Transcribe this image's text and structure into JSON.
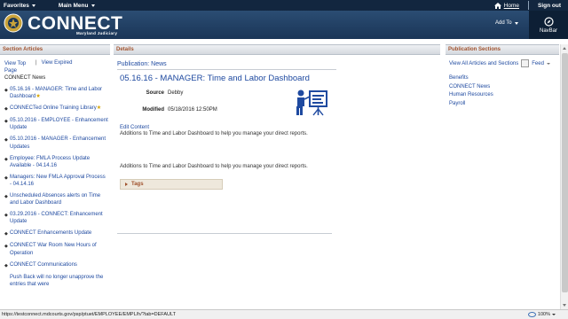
{
  "topbar": {
    "favorites": "Favorites",
    "main_menu": "Main Menu",
    "home": "Home",
    "sign_out": "Sign out"
  },
  "header": {
    "title": "CONNECT",
    "subtitle": "Maryland Judiciary",
    "add_to": "Add To",
    "navbar": "NavBar"
  },
  "left": {
    "heading": "Section Articles",
    "view_top": "View Top Page",
    "view_expired": "View Expired",
    "connect_news": "CONNECT News",
    "articles": [
      "05.16.16 - MANAGER: Time and Labor Dashboard",
      "CONNECTed Online Training Library",
      "05.10.2016 - EMPLOYEE - Enhancement Update",
      "05.10.2016 - MANAGER - Enhancement Updates",
      "Employee: FMLA Process Update Available - 04.14.16",
      "Managers: New FMLA Approval Process - 04.14.16",
      "Unscheduled Absences alerts on Time and Labor Dashboard",
      "03.29.2016 - CONNECT: Enhancement Update",
      "CONNECT Enhancements Update",
      "CONNECT War Room New Hours of Operation",
      "CONNECT Communications",
      "Push Back will no longer unapprove the entries that were"
    ]
  },
  "main": {
    "heading": "Details",
    "publication": "Publication: News",
    "title": "05.16.16 - MANAGER: Time and Labor Dashboard",
    "source_label": "Source",
    "source_value": "Debby",
    "modified_label": "Modified",
    "modified_value": "05/18/2016 12:50PM",
    "edit_content": "Edit Content",
    "body1": "Additions to Time and Labor Dashboard to help you manage your direct reports.",
    "body2": "Additions to Time and Labor Dashboard to help you manage your direct reports.",
    "tags": "Tags"
  },
  "right": {
    "heading": "Publication Sections",
    "view_all": "View All Articles and Sections",
    "feed": "Feed",
    "sections": [
      "Benefits",
      "CONNECT News",
      "Human Resources",
      "Payroll"
    ]
  },
  "status": {
    "url": "https://testconnect.mdcourts.gov/psp/ptuet/EMPLOYEE/EMPL/h/?tab=DEFAULT",
    "zoom": "100%"
  },
  "colors": {
    "topbar": "#12263f",
    "header": "#2b4d73",
    "link": "#1f4aa0",
    "section_heading": "#a0522d"
  }
}
